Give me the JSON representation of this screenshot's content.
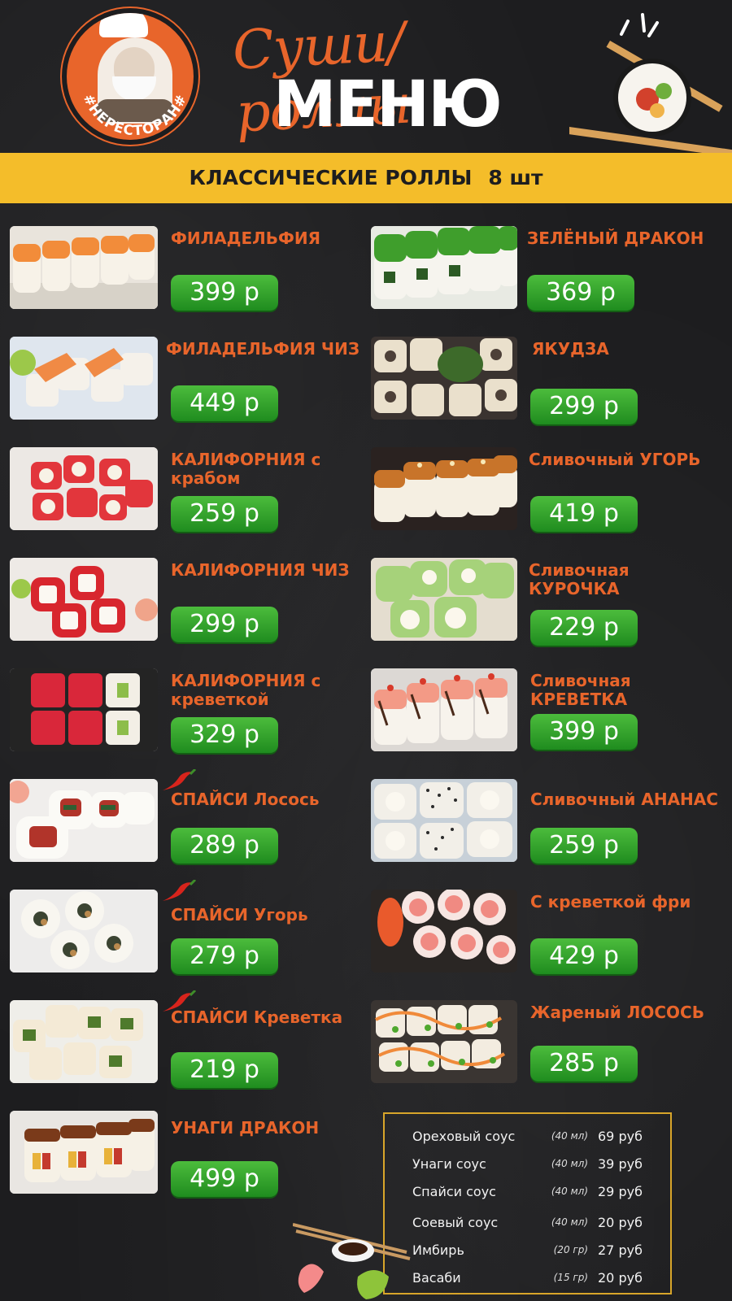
{
  "header": {
    "logo_text": "#НЕРЕСТОРАН#",
    "title_script": "Суши/роллы",
    "title_main": "МЕНЮ"
  },
  "banner": {
    "title": "КЛАССИЧЕСКИЕ РОЛЛЫ",
    "qty": "8 шт"
  },
  "colors": {
    "background": "#1d1d1f",
    "banner": "#f4bd2a",
    "item_name": "#e8652b",
    "price_button": "#2fa32b",
    "sauce_border": "#d8a52a"
  },
  "left_column": [
    {
      "name": "ФИЛАДЕЛЬФИЯ",
      "price": "399 р",
      "spicy": false,
      "image": "philadelphia-roll"
    },
    {
      "name": "ФИЛАДЕЛЬФИЯ ЧИЗ",
      "price": "449 р",
      "spicy": false,
      "image": "philadelphia-cheese-roll"
    },
    {
      "name": "КАЛИФОРНИЯ с крабом",
      "price": "259 р",
      "spicy": false,
      "image": "california-crab-roll"
    },
    {
      "name": "КАЛИФОРНИЯ ЧИЗ",
      "price": "299 р",
      "spicy": false,
      "image": "california-cheese-roll"
    },
    {
      "name": "КАЛИФОРНИЯ с креветкой",
      "price": "329 р",
      "spicy": false,
      "image": "california-shrimp-roll"
    },
    {
      "name": "СПАЙСИ Лосось",
      "price": "289 р",
      "spicy": true,
      "image": "spicy-salmon-roll"
    },
    {
      "name": "СПАЙСИ Угорь",
      "price": "279 р",
      "spicy": true,
      "image": "spicy-eel-roll"
    },
    {
      "name": "СПАЙСИ Креветка",
      "price": "219 р",
      "spicy": true,
      "image": "spicy-shrimp-roll"
    },
    {
      "name": "УНАГИ ДРАКОН",
      "price": "499 р",
      "spicy": false,
      "image": "unagi-dragon-roll"
    }
  ],
  "right_column": [
    {
      "name": "ЗЕЛЁНЫЙ ДРАКОН",
      "price": "369 р",
      "image": "green-dragon-roll"
    },
    {
      "name": "ЯКУДЗА",
      "price": "299 р",
      "image": "yakuza-roll"
    },
    {
      "name": "Сливочный УГОРЬ",
      "price": "419 р",
      "image": "creamy-eel-roll"
    },
    {
      "name": "Сливочная КУРОЧКА",
      "price": "229 р",
      "image": "creamy-chicken-roll"
    },
    {
      "name": "Сливочная КРЕВЕТКА",
      "price": "399 р",
      "image": "creamy-shrimp-roll"
    },
    {
      "name": "Сливочный АНАНАС",
      "price": "259 р",
      "image": "creamy-pineapple-roll"
    },
    {
      "name": "С креветкой фри",
      "price": "429 р",
      "image": "fried-shrimp-roll"
    },
    {
      "name": "Жареный ЛОСОСЬ",
      "price": "285 р",
      "image": "fried-salmon-roll"
    }
  ],
  "sauces": [
    {
      "name": "Ореховый соус",
      "volume": "(40 мл)",
      "price": "69 руб"
    },
    {
      "name": "Унаги соус",
      "volume": "(40 мл)",
      "price": "39 руб"
    },
    {
      "name": "Спайси соус",
      "volume": "(40 мл)",
      "price": "29 руб"
    },
    {
      "name": "Соевый соус",
      "volume": "(40 мл)",
      "price": "20 руб"
    },
    {
      "name": "Имбирь",
      "volume": "(20 гр)",
      "price": "27 руб"
    },
    {
      "name": "Васаби",
      "volume": "(15 гр)",
      "price": "20 руб"
    }
  ]
}
